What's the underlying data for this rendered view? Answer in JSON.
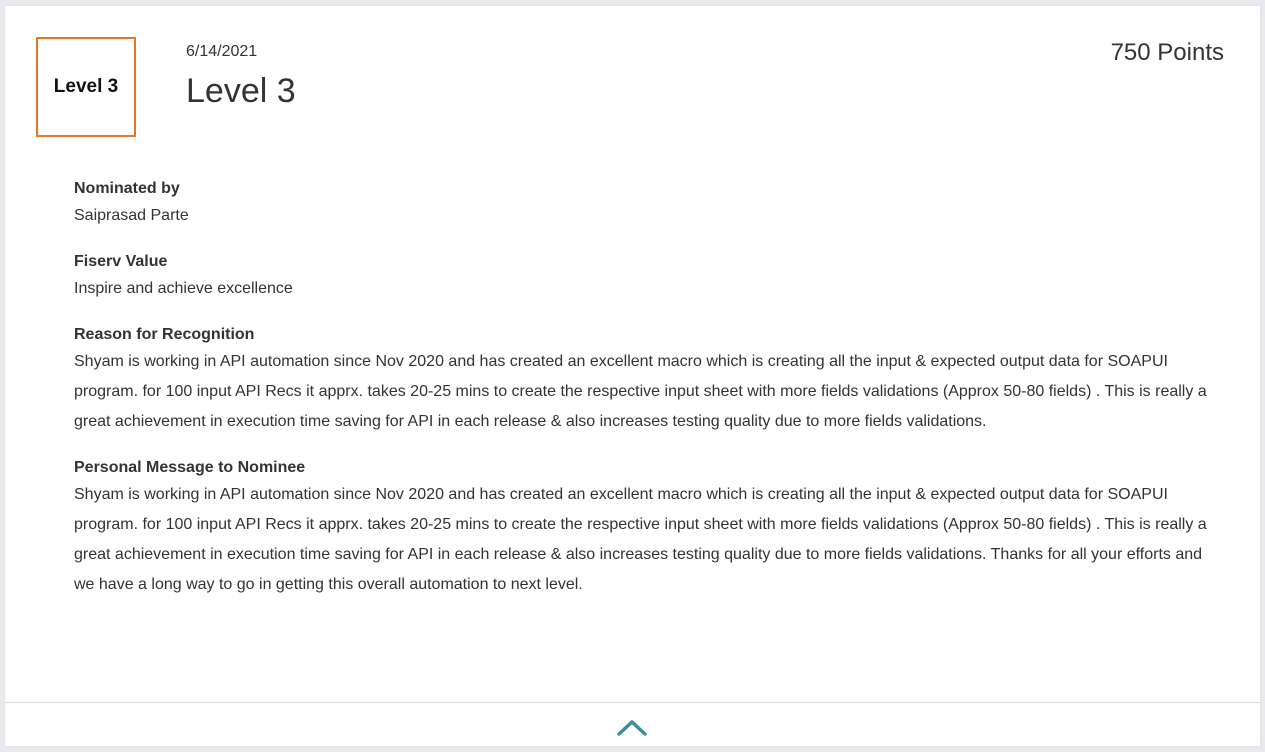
{
  "badge": {
    "label": "Level 3",
    "border_color": "#e87722"
  },
  "header": {
    "date": "6/14/2021",
    "title": "Level 3",
    "points": "750 Points"
  },
  "details": {
    "nominated_by": {
      "label": "Nominated by",
      "value": "Saiprasad Parte"
    },
    "fiserv_value": {
      "label": "Fiserv Value",
      "value": "Inspire and achieve excellence"
    },
    "reason": {
      "label": "Reason for Recognition",
      "value": "Shyam is working in API automation since Nov 2020 and has created an excellent macro which is creating all the input & expected output data for SOAPUI program. for 100 input API Recs it apprx. takes 20-25 mins to create the respective input sheet with more fields validations (Approx 50-80 fields) . This is really a great achievement in execution time saving for API in each release & also increases testing quality due to more fields validations."
    },
    "message": {
      "label": "Personal Message to Nominee",
      "value": "Shyam is working in API automation since Nov 2020 and has created an excellent macro which is creating all the input & expected output data for SOAPUI program. for 100 input API Recs it apprx. takes 20-25 mins to create the respective input sheet with more fields validations (Approx 50-80 fields) . This is really a great achievement in execution time saving for API in each release & also increases testing quality due to more fields validations. Thanks for all your efforts and we have a long way to go in getting this overall automation to next level."
    }
  },
  "collapse": {
    "icon": "chevron-up-icon",
    "color": "#3a8f9a"
  }
}
